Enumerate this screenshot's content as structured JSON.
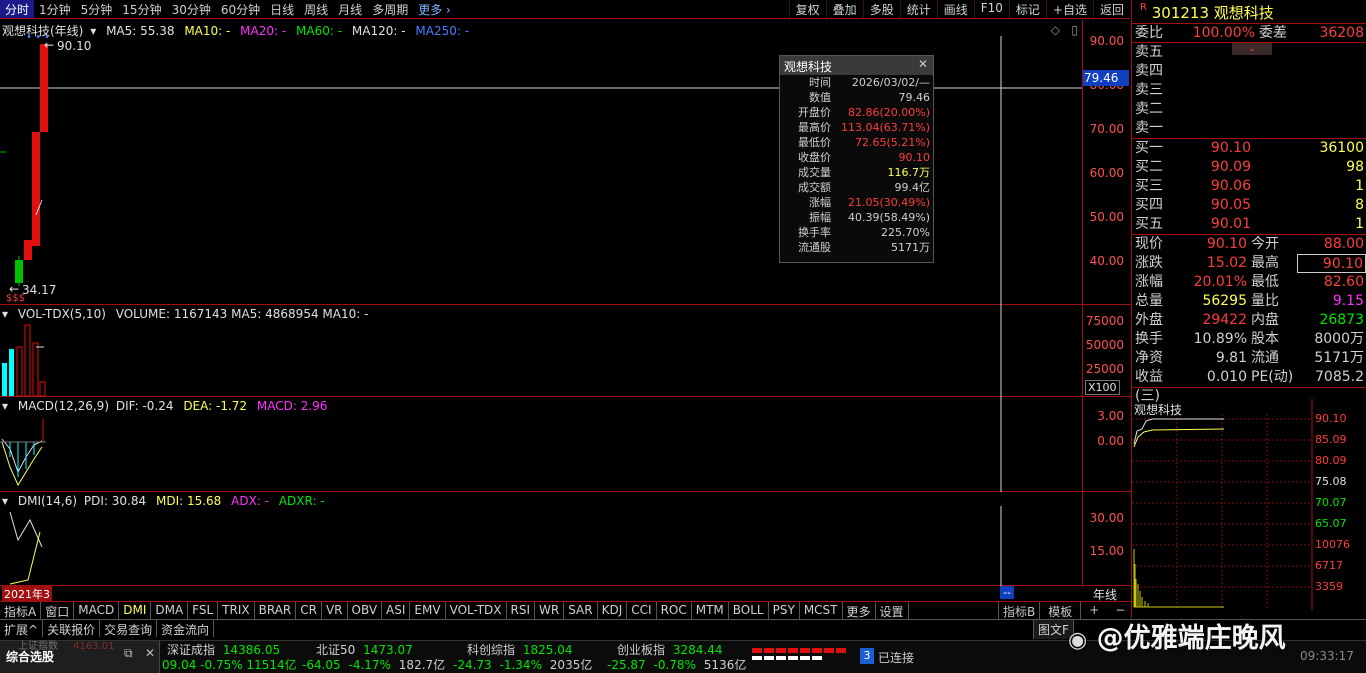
{
  "toolbar": {
    "periods": [
      "分时",
      "1分钟",
      "5分钟",
      "15分钟",
      "30分钟",
      "60分钟",
      "日线",
      "周线",
      "月线",
      "多周期"
    ],
    "more": "更多 ›",
    "right": [
      "复权",
      "叠加",
      "多股",
      "统计",
      "画线",
      "F10",
      "标记",
      "+自选",
      "返回"
    ]
  },
  "main": {
    "title": "观想科技(年线)",
    "ma": [
      {
        "t": "MA5: 55.38",
        "c": "#e0e0e0"
      },
      {
        "t": "MA10: -",
        "c": "#ffff54"
      },
      {
        "t": "MA20: -",
        "c": "#ff30ff"
      },
      {
        "t": "MA60: -",
        "c": "#00e600"
      },
      {
        "t": "MA120: -",
        "c": "#e0e0e0"
      },
      {
        "t": "MA250: -",
        "c": "#4a7aff"
      }
    ],
    "high_label": "90.10",
    "low_label": "34.17",
    "sss": "$$$",
    "ticks": [
      "90.00",
      "80.00",
      "70.00",
      "60.00",
      "50.00",
      "40.00"
    ],
    "cursor_price": "79.46"
  },
  "vol": {
    "title": "VOL-TDX(5,10)",
    "values": "VOLUME: 1167143  MA5: 4868954  MA10: -",
    "ticks": [
      "75000",
      "50000",
      "25000"
    ],
    "unit": "X100"
  },
  "macd": {
    "title": "MACD(12,26,9)",
    "dif": "DIF: -0.24",
    "dea": "DEA: -1.72",
    "macd": "MACD: 2.96",
    "ticks": [
      "3.00",
      "0.00"
    ]
  },
  "dmi": {
    "title": "DMI(14,6)",
    "pdi": "PDI: 30.84",
    "mdi": "MDI: 15.68",
    "adx": "ADX: -",
    "adxr": "ADXR: -",
    "ticks": [
      "30.00",
      "15.00"
    ],
    "year": "2021年3",
    "cursor": "--",
    "period": "年线"
  },
  "tooltip": {
    "title": "观想科技",
    "rows": [
      {
        "k": "时间",
        "v": "2026/03/02/—",
        "c": "#d0d0d0"
      },
      {
        "k": "数值",
        "v": "79.46",
        "c": "#d0d0d0"
      },
      {
        "k": "开盘价",
        "v": "82.86(20.00%)",
        "c": "#ff3c3c"
      },
      {
        "k": "最高价",
        "v": "113.04(63.71%)",
        "c": "#ff3c3c"
      },
      {
        "k": "最低价",
        "v": "72.65(5.21%)",
        "c": "#ff3c3c"
      },
      {
        "k": "收盘价",
        "v": "90.10",
        "c": "#ff3c3c"
      },
      {
        "k": "成交量",
        "v": "116.7万",
        "c": "#ffff54"
      },
      {
        "k": "成交额",
        "v": "99.4亿",
        "c": "#d0d0d0"
      },
      {
        "k": "涨幅",
        "v": "21.05(30.49%)",
        "c": "#ff3c3c"
      },
      {
        "k": "振幅",
        "v": "40.39(58.49%)",
        "c": "#d0d0d0"
      },
      {
        "k": "换手率",
        "v": "225.70%",
        "c": "#d0d0d0"
      },
      {
        "k": "流通股",
        "v": "5171万",
        "c": "#d0d0d0"
      }
    ]
  },
  "quote": {
    "badge": "R",
    "code": "301213",
    "name": "观想科技",
    "wb_label": "委比",
    "wb": "100.00%",
    "wc_label": "委差",
    "wc": "36208",
    "sells": [
      {
        "l": "卖五",
        "p": "",
        "v": ""
      },
      {
        "l": "卖四",
        "p": "",
        "v": ""
      },
      {
        "l": "卖三",
        "p": "",
        "v": ""
      },
      {
        "l": "卖二",
        "p": "",
        "v": ""
      },
      {
        "l": "卖一",
        "p": "",
        "v": ""
      }
    ],
    "buys": [
      {
        "l": "买一",
        "p": "90.10",
        "v": "36100"
      },
      {
        "l": "买二",
        "p": "90.09",
        "v": "98"
      },
      {
        "l": "买三",
        "p": "90.06",
        "v": "1"
      },
      {
        "l": "买四",
        "p": "90.05",
        "v": "8"
      },
      {
        "l": "买五",
        "p": "90.01",
        "v": "1"
      }
    ],
    "stats": [
      {
        "l": "现价",
        "a": "90.10",
        "ac": "#ff3c3c",
        "l2": "今开",
        "b": "88.00",
        "bc": "#ff3c3c"
      },
      {
        "l": "涨跌",
        "a": "15.02",
        "ac": "#ff3c3c",
        "l2": "最高",
        "b": "90.10",
        "bc": "#ff3c3c"
      },
      {
        "l": "涨幅",
        "a": "20.01%",
        "ac": "#ff3c3c",
        "l2": "最低",
        "b": "82.60",
        "bc": "#ff3c3c"
      },
      {
        "l": "总量",
        "a": "56295",
        "ac": "#ffff54",
        "l2": "量比",
        "b": "9.15",
        "bc": "#ff30ff"
      },
      {
        "l": "外盘",
        "a": "29422",
        "ac": "#ff3c3c",
        "l2": "内盘",
        "b": "26873",
        "bc": "#00e600"
      },
      {
        "l": "换手",
        "a": "10.89%",
        "ac": "#d0d0d0",
        "l2": "股本",
        "b": "8000万",
        "bc": "#d0d0d0"
      },
      {
        "l": "净资",
        "a": "9.81",
        "ac": "#d0d0d0",
        "l2": "流通",
        "b": "5171万",
        "bc": "#d0d0d0"
      },
      {
        "l": "收益(三)",
        "a": "0.010",
        "ac": "#d0d0d0",
        "l2": "PE(动)",
        "b": "7085.2",
        "bc": "#d0d0d0"
      }
    ]
  },
  "mini": {
    "title": "观想科技",
    "ticks": [
      "90.10",
      "85.09",
      "80.09",
      "75.08",
      "70.07",
      "65.07",
      "10076",
      "6717",
      "3359"
    ]
  },
  "tabs": [
    "指标A",
    "窗口",
    "MACD",
    "DMI",
    "DMA",
    "FSL",
    "TRIX",
    "BRAR",
    "CR",
    "VR",
    "OBV",
    "ASI",
    "EMV",
    "VOL-TDX",
    "RSI",
    "WR",
    "SAR",
    "KDJ",
    "CCI",
    "ROC",
    "MTM",
    "BOLL",
    "PSY",
    "MCST",
    "更多",
    "设置"
  ],
  "tabs_right": [
    "指标B",
    "模板",
    "+",
    "−"
  ],
  "row2": [
    "扩展^",
    "关联报价",
    "交易查询",
    "资金流向"
  ],
  "row2_right": "图文F",
  "status": {
    "panel": "综合选股",
    "sh": {
      "name": "上证指数",
      "val": "4163.01"
    },
    "indices": [
      {
        "name": "深证成指",
        "val": "14386.05",
        "chg": "-64.05",
        "pct": "-4.17%",
        "amt": "182.7亿",
        "lead": "09.04  -0.75%  11514亿"
      },
      {
        "name": "北证50",
        "val": "1473.07",
        "chg": "-24.73",
        "pct": "-1.34%",
        "amt": "2035亿"
      },
      {
        "name": "科创综指",
        "val": "1825.04",
        "chg": "-25.87",
        "pct": "-0.78%",
        "amt": "5136亿"
      },
      {
        "name": "创业板指",
        "val": "3284.44"
      }
    ],
    "conn_num": "3",
    "conn": "已连接",
    "time": "09:33:17"
  },
  "watermark": "@优雅端庄晚风"
}
